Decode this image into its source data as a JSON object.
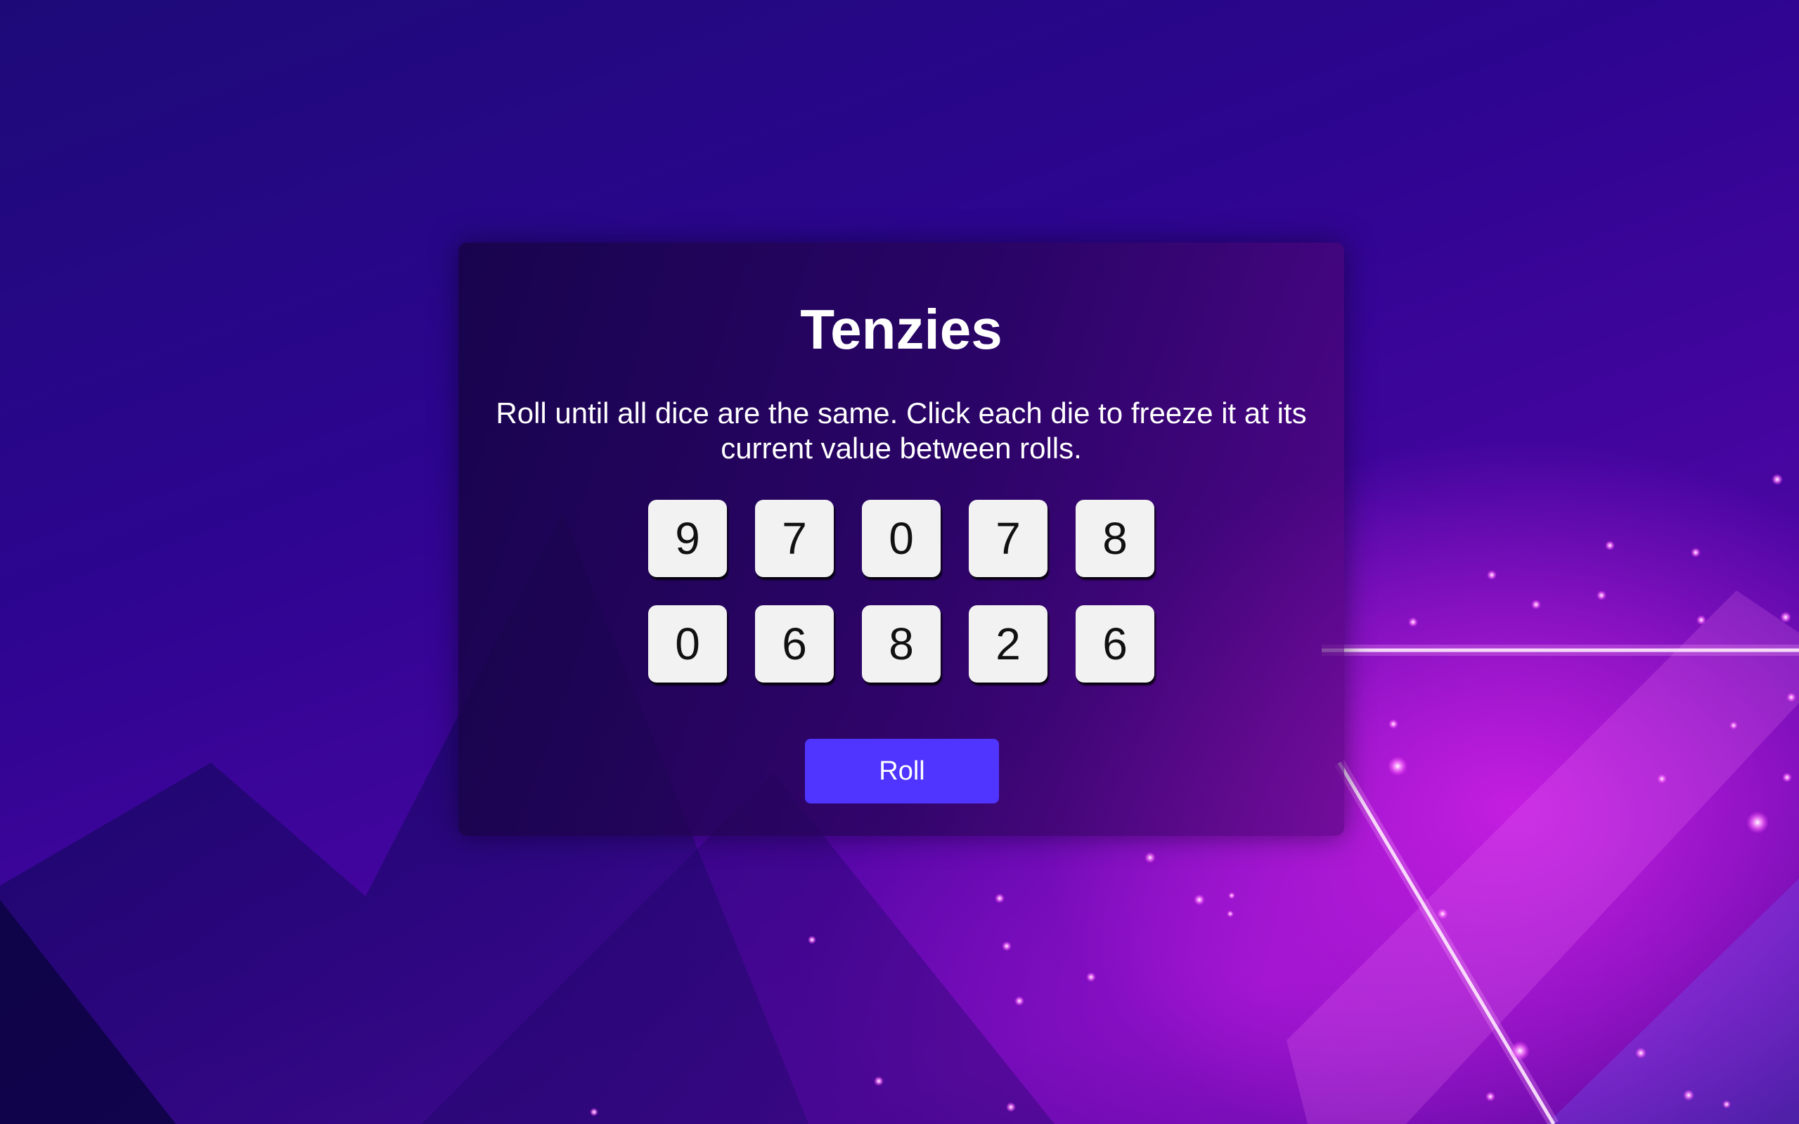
{
  "game": {
    "title": "Tenzies",
    "instructions": "Roll until all dice are the same. Click each die to freeze it at its current value between rolls.",
    "dice": [
      9,
      7,
      0,
      7,
      8,
      0,
      6,
      8,
      2,
      6
    ],
    "roll_label": "Roll"
  },
  "theme": {
    "background_primary": "#2d0590",
    "background_accent": "#c41ee0",
    "die_face": "#f2f2f2",
    "button_color": "#4f35ff"
  }
}
